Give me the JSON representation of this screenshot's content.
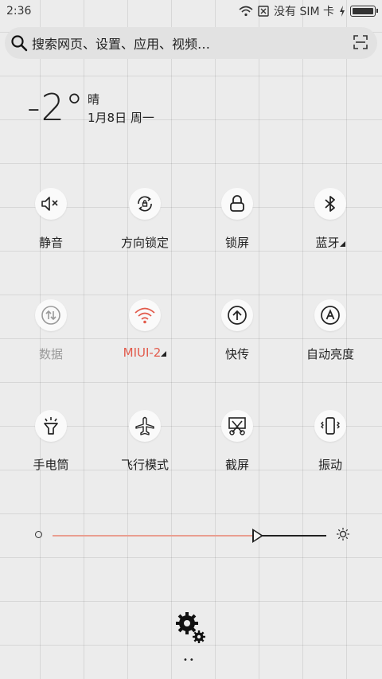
{
  "status_bar": {
    "time": "2:36",
    "sim_text": "没有 SIM 卡",
    "icons": [
      "wifi-icon",
      "no-sim-icon",
      "charging-icon",
      "battery-icon"
    ]
  },
  "search": {
    "placeholder": "搜索网页、设置、应用、视频…",
    "icons": [
      "search-icon",
      "scan-icon"
    ]
  },
  "weather": {
    "temperature": "-2°",
    "condition": "晴",
    "date": "1月8日 周一"
  },
  "toggles": [
    {
      "label": "静音",
      "icon": "mute-icon",
      "state": "on"
    },
    {
      "label": "方向锁定",
      "icon": "rotation-lock-icon",
      "state": "on"
    },
    {
      "label": "锁屏",
      "icon": "lock-icon",
      "state": "on"
    },
    {
      "label": "蓝牙",
      "icon": "bluetooth-icon",
      "state": "on",
      "has_more": true
    },
    {
      "label": "数据",
      "icon": "data-icon",
      "state": "off"
    },
    {
      "label": "MIUI-2",
      "icon": "wifi-icon",
      "state": "active",
      "has_more": true
    },
    {
      "label": "快传",
      "icon": "transfer-icon",
      "state": "on"
    },
    {
      "label": "自动亮度",
      "icon": "auto-brightness-icon",
      "state": "on"
    },
    {
      "label": "手电筒",
      "icon": "flashlight-icon",
      "state": "on"
    },
    {
      "label": "飞行模式",
      "icon": "airplane-icon",
      "state": "on"
    },
    {
      "label": "截屏",
      "icon": "screenshot-icon",
      "state": "on"
    },
    {
      "label": "振动",
      "icon": "vibrate-icon",
      "state": "on"
    }
  ],
  "brightness": {
    "level": 0.73,
    "icons": [
      "brightness-low-icon",
      "brightness-high-icon"
    ]
  },
  "colors": {
    "accent": "#e25a4b",
    "slider_active": "#e99e90",
    "dim": "#9a9a9a"
  },
  "footer": {
    "icon": "settings-icon",
    "page_indicator": "••"
  }
}
